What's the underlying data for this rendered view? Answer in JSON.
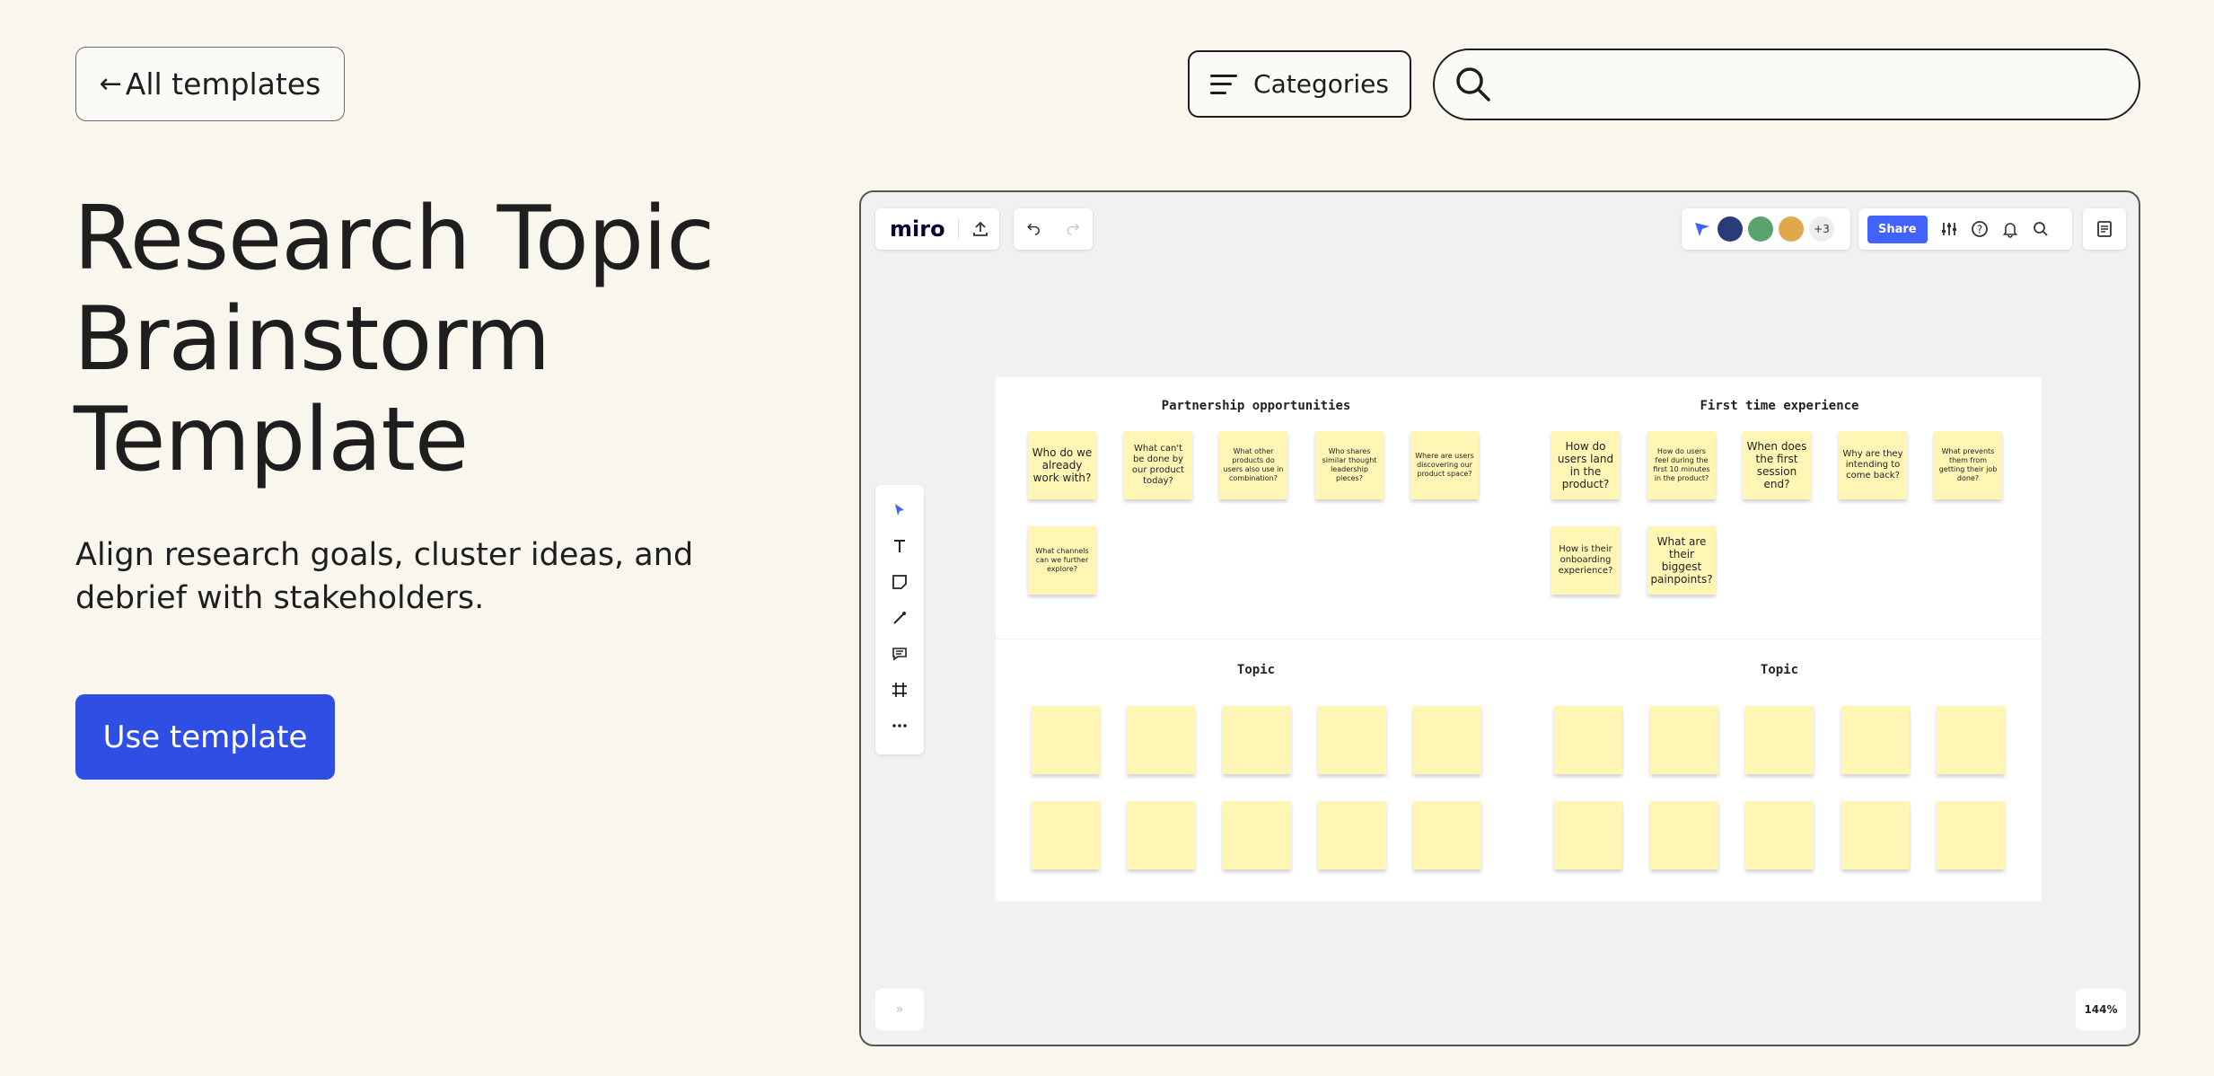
{
  "nav": {
    "back_label": "All templates",
    "back_arrow": "←",
    "categories_label": "Categories",
    "search_placeholder": ""
  },
  "hero": {
    "title": "Research Topic Brainstorm Template",
    "subtitle": "Align research goals, cluster ideas, and debrief with stakeholders.",
    "cta_label": "Use template"
  },
  "preview": {
    "logo": "miro",
    "collaborators_more": "+3",
    "share_label": "Share",
    "zoom_level": "144%",
    "nav_mini": "»",
    "accent": "#4262ff",
    "sticky_color": "#fff6b6",
    "quadrants": [
      {
        "title": "Partnership opportunities",
        "notes": [
          "Who do we already work with?",
          "What can't be done by our product today?",
          "What other products do users also use in combination?",
          "Who shares similar thought leadership pieces?",
          "Where are users discovering our product space?",
          "What channels can we further explore?"
        ]
      },
      {
        "title": "First time experience",
        "notes": [
          "How do users land in the product?",
          "How do users feel during the first 10 minutes in the product?",
          "When does the first session end?",
          "Why are they intending to come back?",
          "What prevents them from getting their job done?",
          "How is their onboarding experience?",
          "What are their biggest painpoints?"
        ]
      },
      {
        "title": "Topic",
        "notes": []
      },
      {
        "title": "Topic",
        "notes": []
      }
    ]
  }
}
